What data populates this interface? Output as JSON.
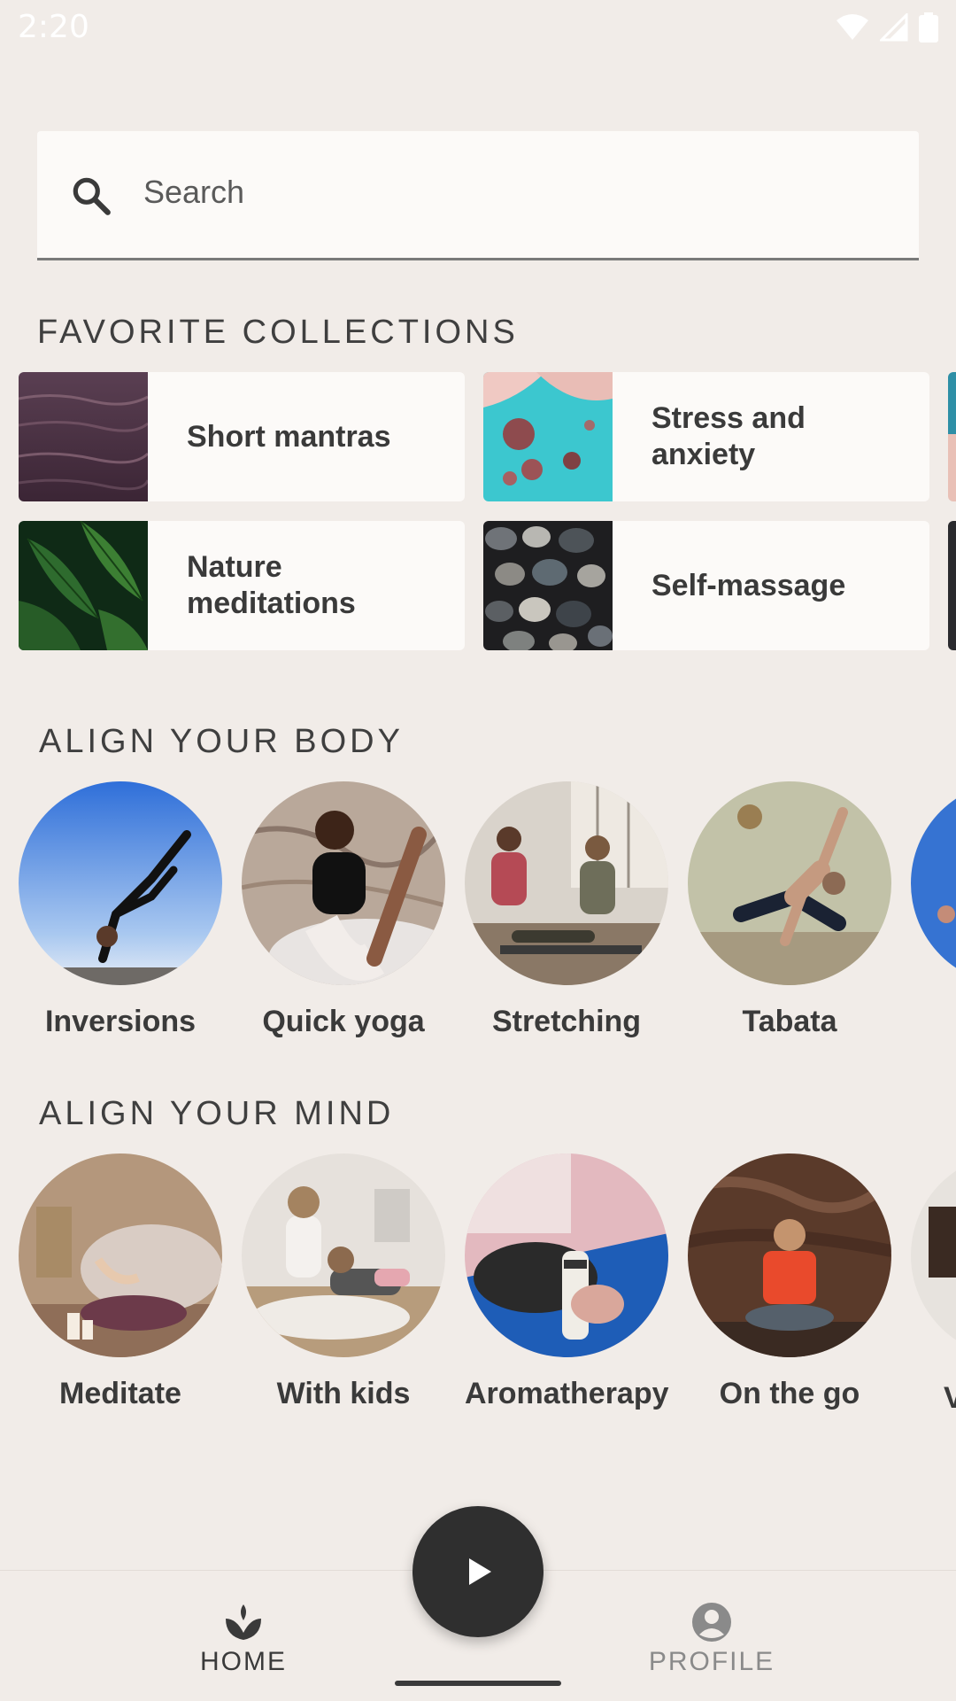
{
  "status_bar": {
    "time": "2:20",
    "icons": [
      "wifi-icon",
      "signal-icon",
      "battery-icon"
    ]
  },
  "search": {
    "placeholder": "Search",
    "icon": "search-icon"
  },
  "favorite_collections": {
    "title": "FAVORITE COLLECTIONS",
    "items": [
      {
        "label": "Short mantras",
        "image": "dark-water-ripples"
      },
      {
        "label": "Stress and anxiety",
        "image": "turquoise-aerial-shore"
      },
      {
        "label": "Nature meditations",
        "image": "green-monstera-leaves"
      },
      {
        "label": "Self-massage",
        "image": "pebble-stones"
      }
    ]
  },
  "align_body": {
    "title": "ALIGN YOUR BODY",
    "items": [
      {
        "label": "Inversions",
        "image": "yoga-crow-pose-sky"
      },
      {
        "label": "Quick yoga",
        "image": "woman-stretching-leg"
      },
      {
        "label": "Stretching",
        "image": "two-women-stretching-studio"
      },
      {
        "label": "Tabata",
        "image": "man-side-plank"
      }
    ]
  },
  "align_mind": {
    "title": "ALIGN YOUR MIND",
    "items": [
      {
        "label": "Meditate",
        "image": "meditating-hands-candle"
      },
      {
        "label": "With kids",
        "image": "mother-child-yoga"
      },
      {
        "label": "Aromatherapy",
        "image": "sage-bundle-hand"
      },
      {
        "label": "On the go",
        "image": "man-meditating-rock"
      }
    ]
  },
  "nav": {
    "home_label": "HOME",
    "profile_label": "PROFILE",
    "play_icon": "play-icon"
  },
  "colors": {
    "background": "#F1ECE8",
    "surface": "#FCFAF8",
    "text": "#3A3A3A",
    "fab": "#2F2F2F"
  }
}
